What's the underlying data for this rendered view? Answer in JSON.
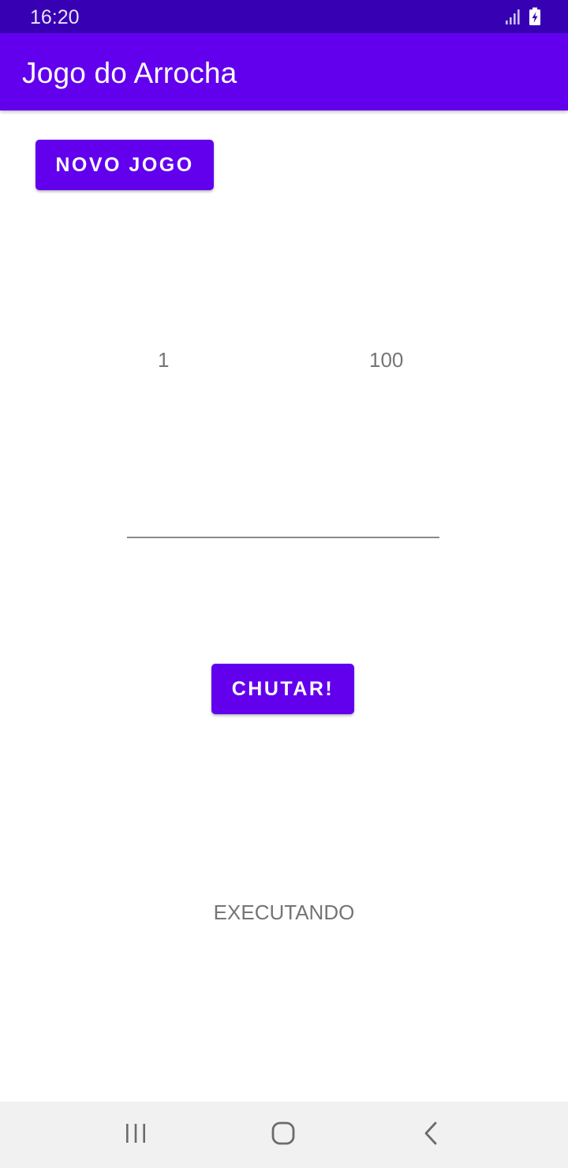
{
  "status_bar": {
    "time": "16:20",
    "icons": [
      "signal-icon",
      "battery-charging-icon"
    ]
  },
  "app_bar": {
    "title": "Jogo do Arrocha"
  },
  "buttons": {
    "new_game": "NOVO JOGO",
    "guess": "CHUTAR!"
  },
  "range": {
    "min": "1",
    "max": "100"
  },
  "guess_input": {
    "value": ""
  },
  "game_status": "EXECUTANDO",
  "nav_bar": {
    "icons": [
      "recents-icon",
      "home-icon",
      "back-icon"
    ]
  },
  "colors": {
    "primary": "#6200ee",
    "primary_dark": "#3700b3",
    "text_secondary": "#757575",
    "nav_background": "#f1f1f1"
  }
}
